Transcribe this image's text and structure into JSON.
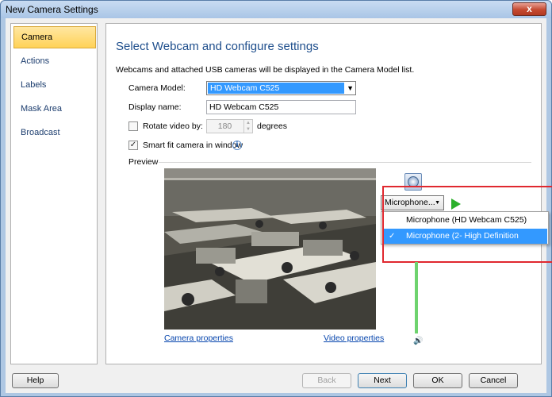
{
  "window": {
    "title": "New Camera Settings",
    "close": "x"
  },
  "nav": {
    "items": [
      "Camera",
      "Actions",
      "Labels",
      "Mask Area",
      "Broadcast"
    ]
  },
  "main": {
    "heading": "Select Webcam and configure settings",
    "description": "Webcams and attached USB cameras will be displayed in the Camera Model list.",
    "camera_model_label": "Camera Model:",
    "camera_model_value": "HD Webcam C525",
    "display_name_label": "Display name:",
    "display_name_value": "HD Webcam C525",
    "rotate_label": "Rotate video by:",
    "rotate_checked": false,
    "rotate_value": "180",
    "rotate_unit": "degrees",
    "smart_fit_label": "Smart fit camera in window",
    "smart_fit_checked": true,
    "info_icon": "i",
    "preview_label": "Preview",
    "camera_properties_link": "Camera properties",
    "video_properties_link": "Video properties"
  },
  "audio": {
    "mic_dropdown_value": "Microphone...",
    "options": [
      "Microphone (HD Webcam C525)",
      "Microphone (2- High Definition"
    ],
    "selected_index": 1,
    "check_mark": "✓",
    "speaker_icon": "🔊"
  },
  "footer": {
    "help": "Help",
    "back": "Back",
    "next": "Next",
    "ok": "OK",
    "cancel": "Cancel"
  },
  "colors": {
    "accent": "#1e4e8c",
    "selection": "#3399ff",
    "highlight_border": "#e0282f",
    "nav_active": "#ffd257"
  }
}
